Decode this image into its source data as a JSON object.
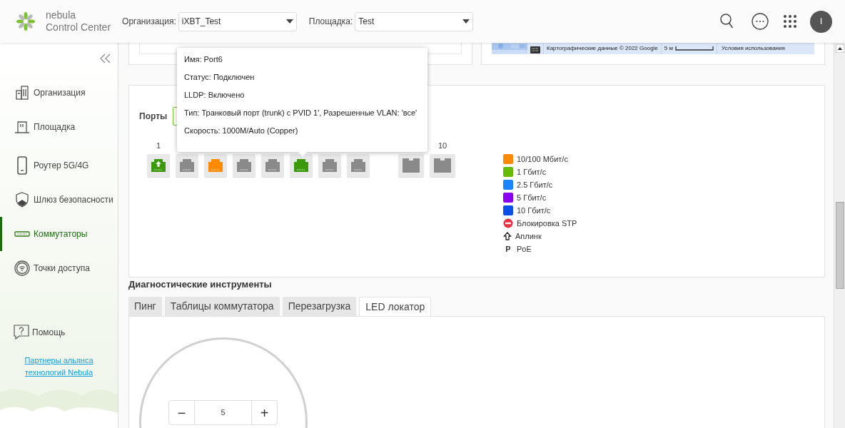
{
  "header": {
    "logo_line1": "nebula",
    "logo_line2": "Control Center",
    "org": {
      "label": "Организация:",
      "value": "iXBT_Test"
    },
    "site": {
      "label": "Площадка:",
      "value": "Test"
    },
    "avatar": "I"
  },
  "sidebar": {
    "items": [
      {
        "label": "Организация",
        "selected": false
      },
      {
        "label": "Площадка",
        "selected": false
      },
      {
        "label": "Роутер 5G/4G",
        "selected": false
      },
      {
        "label": "Шлюз безопасности",
        "selected": false
      },
      {
        "label": "Коммутаторы",
        "selected": true
      },
      {
        "label": "Точки доступа",
        "selected": false
      }
    ],
    "help": "Помощь",
    "partner_link": "Партнеры альянса технологий Nebula"
  },
  "map": {
    "attribution": "Картографические данные © 2022 Google",
    "scale": "5 м",
    "terms": "Условия использования"
  },
  "ports_panel": {
    "title": "Порты",
    "first_label": "1",
    "last_label": "10",
    "ports": [
      {
        "kind": "rj45",
        "color": "#3a9a0a",
        "uplink": true
      },
      {
        "kind": "rj45",
        "color": "#8a8a8a",
        "uplink": false
      },
      {
        "kind": "rj45",
        "color": "#ff8a00",
        "uplink": false
      },
      {
        "kind": "rj45",
        "color": "#8a8a8a",
        "uplink": false
      },
      {
        "kind": "rj45",
        "color": "#8a8a8a",
        "uplink": false
      },
      {
        "kind": "rj45",
        "color": "#3a9a0a",
        "uplink": false
      },
      {
        "kind": "rj45",
        "color": "#8a8a8a",
        "uplink": false
      },
      {
        "kind": "rj45",
        "color": "#8a8a8a",
        "uplink": false
      },
      {
        "kind": "sfp",
        "color": "#8a8a8a",
        "uplink": false
      },
      {
        "kind": "sfp",
        "color": "#8a8a8a",
        "uplink": false
      }
    ],
    "legend": [
      {
        "kind": "swatch",
        "color": "#ff8a00",
        "label": "10/100 Мбит/с"
      },
      {
        "kind": "swatch",
        "color": "#66bb00",
        "label": "1 Гбит/с"
      },
      {
        "kind": "swatch",
        "color": "#1a85ff",
        "label": "2.5 Гбит/с"
      },
      {
        "kind": "swatch",
        "color": "#8a00f0",
        "label": "5 Гбит/с"
      },
      {
        "kind": "swatch",
        "color": "#0a4fe8",
        "label": "10 Гбит/с"
      },
      {
        "kind": "stp",
        "label": "Блокировка STP"
      },
      {
        "kind": "uplink",
        "label": "Аплинк"
      },
      {
        "kind": "poe",
        "symbol": "P",
        "label": "PoE"
      }
    ]
  },
  "tooltip": {
    "lines": [
      "Имя: Port6",
      "Статус: Подключен",
      "LLDP: Включено",
      "Тип: Транковый порт (trunk) с PVID 1', Разрешенные VLAN: 'все'",
      "Скорость: 1000M/Auto (Copper)"
    ]
  },
  "diagnostics": {
    "title": "Диагностические инструменты",
    "tabs": [
      {
        "label": "Пинг",
        "selected": false
      },
      {
        "label": "Таблицы коммутатора",
        "selected": false
      },
      {
        "label": "Перезагрузка",
        "selected": false
      },
      {
        "label": "LED локатор",
        "selected": true
      }
    ],
    "stepper": {
      "minus": "−",
      "value": "5",
      "plus": "+"
    }
  }
}
